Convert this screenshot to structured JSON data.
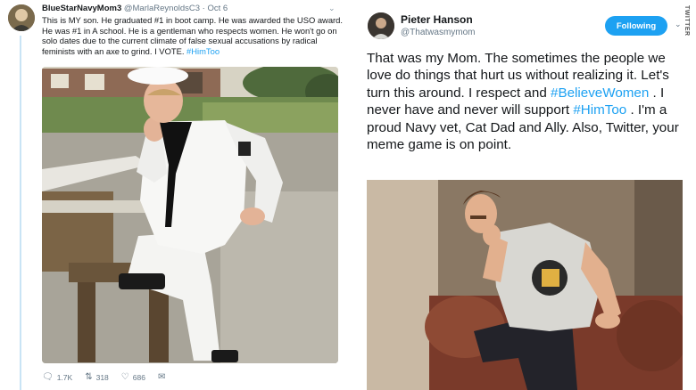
{
  "left_tweet": {
    "display_name": "BlueStarNavyMom3",
    "handle": "@MarlaReynoldsC3",
    "separator": "·",
    "date": "Oct 6",
    "text_before_hashtag": "This is MY son. He graduated #1 in boot camp. He was awarded the USO award. He was #1 in A school. He is a gentleman who respects women. He won't go on solo dates due to the current climate of false sexual accusations by radical feminists with an axe to grind. I VOTE. ",
    "hashtag": "#HimToo",
    "actions": {
      "replies": "1.7K",
      "retweets": "318",
      "likes": "686"
    },
    "icons": [
      "reply-icon",
      "retweet-icon",
      "like-icon",
      "message-icon",
      "chevron-down-icon"
    ]
  },
  "right_tweet": {
    "display_name": "Pieter Hanson",
    "handle": "@Thatwasmymom",
    "follow_label": "Following",
    "text_part1": "That was my Mom. The sometimes the people we love do things that hurt us without realizing it. Let's turn this around. I respect and ",
    "hashtag1": "#BelieveWomen",
    "text_part2": " . I never have and never will support  ",
    "hashtag2": "#HimToo",
    "text_part3": " . I'm a proud Navy vet, Cat Dad and Ally. Also, Twitter, your meme game is on point.",
    "watermark": "TWITTER"
  },
  "colors": {
    "link": "#1da1f2",
    "follow_button": "#1da1f2",
    "thread_line": "#c9e4f5",
    "muted_text": "#657786"
  }
}
